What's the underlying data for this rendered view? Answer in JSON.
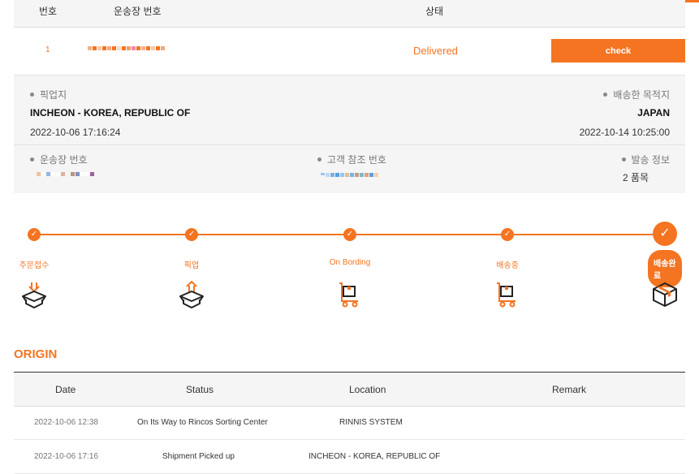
{
  "table_header": {
    "no": "번호",
    "tracking_no": "운송장 번호",
    "status": "상태"
  },
  "shipment": {
    "row_no": "1",
    "status": "Delivered",
    "check_label": "check"
  },
  "details": {
    "pickup_label": "픽업지",
    "pickup_location": "INCHEON - KOREA, REPUBLIC OF",
    "pickup_datetime": "2022-10-06 17:16:24",
    "dest_label": "배송한 목적지",
    "dest_location": "JAPAN",
    "dest_datetime": "2022-10-14 10:25:00",
    "tracking_label": "운송장 번호",
    "customer_ref_label": "고객 참조 번호",
    "shipping_info_label": "발송 정보",
    "shipping_info_value": "2 품목"
  },
  "steps": [
    {
      "label": "주문접수",
      "icon": "box-in-icon"
    },
    {
      "label": "픽업",
      "icon": "box-out-icon"
    },
    {
      "label": "On Bording",
      "icon": "cart-box-icon"
    },
    {
      "label": "배송중",
      "icon": "cart-box-icon"
    },
    {
      "label": "배송완료",
      "icon": "package-icon",
      "active": true
    }
  ],
  "origin_title": "ORIGIN",
  "history_header": {
    "date": "Date",
    "status": "Status",
    "location": "Location",
    "remark": "Remark"
  },
  "history": [
    {
      "date": "2022-10-06 12:38",
      "status": "On Its Way to Rincos Sorting Center",
      "location": "RINNIS SYSTEM",
      "remark": ""
    },
    {
      "date": "2022-10-06 17:16",
      "status": "Shipment Picked up",
      "location": "INCHEON - KOREA, REPUBLIC OF",
      "remark": ""
    }
  ],
  "colors": {
    "accent": "#f47421",
    "panel": "#f5f5f5"
  }
}
